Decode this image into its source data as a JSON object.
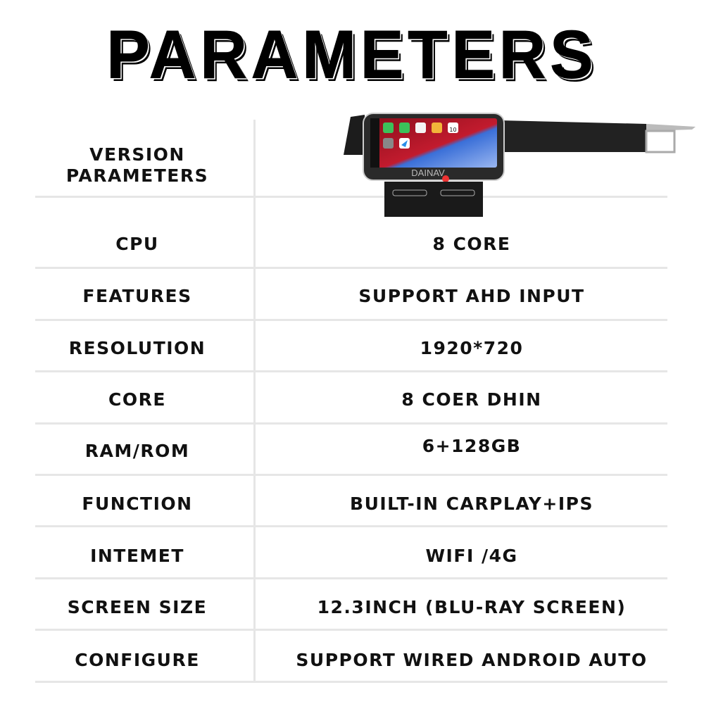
{
  "title": "PARAMETERS",
  "header": {
    "label": "VERSION PARAMETERS"
  },
  "product_image": {
    "watermark": "DAINAV",
    "screen_day": "10"
  },
  "rows": [
    {
      "label": "CPU",
      "value": "8 CORE"
    },
    {
      "label": "FEATURES",
      "value": "SUPPORT AHD INPUT"
    },
    {
      "label": "RESOLUTION",
      "value": "1920*720"
    },
    {
      "label": "CORE",
      "value": "8 COER DHIN"
    },
    {
      "label": "RAM/ROM",
      "value": "6+128GB"
    },
    {
      "label": "FUNCTION",
      "value": "BUILT-IN CARPLAY+IPS"
    },
    {
      "label": "INTEMET",
      "value": "WIFI /4G"
    },
    {
      "label": "SCREEN SIZE",
      "value": "12.3INCH (BLU-RAY SCREEN)"
    },
    {
      "label": "CONFIGURE",
      "value": "SUPPORT WIRED ANDROID AUTO"
    }
  ],
  "colors": {
    "divider": "#e6e6e6",
    "text": "#111111"
  }
}
